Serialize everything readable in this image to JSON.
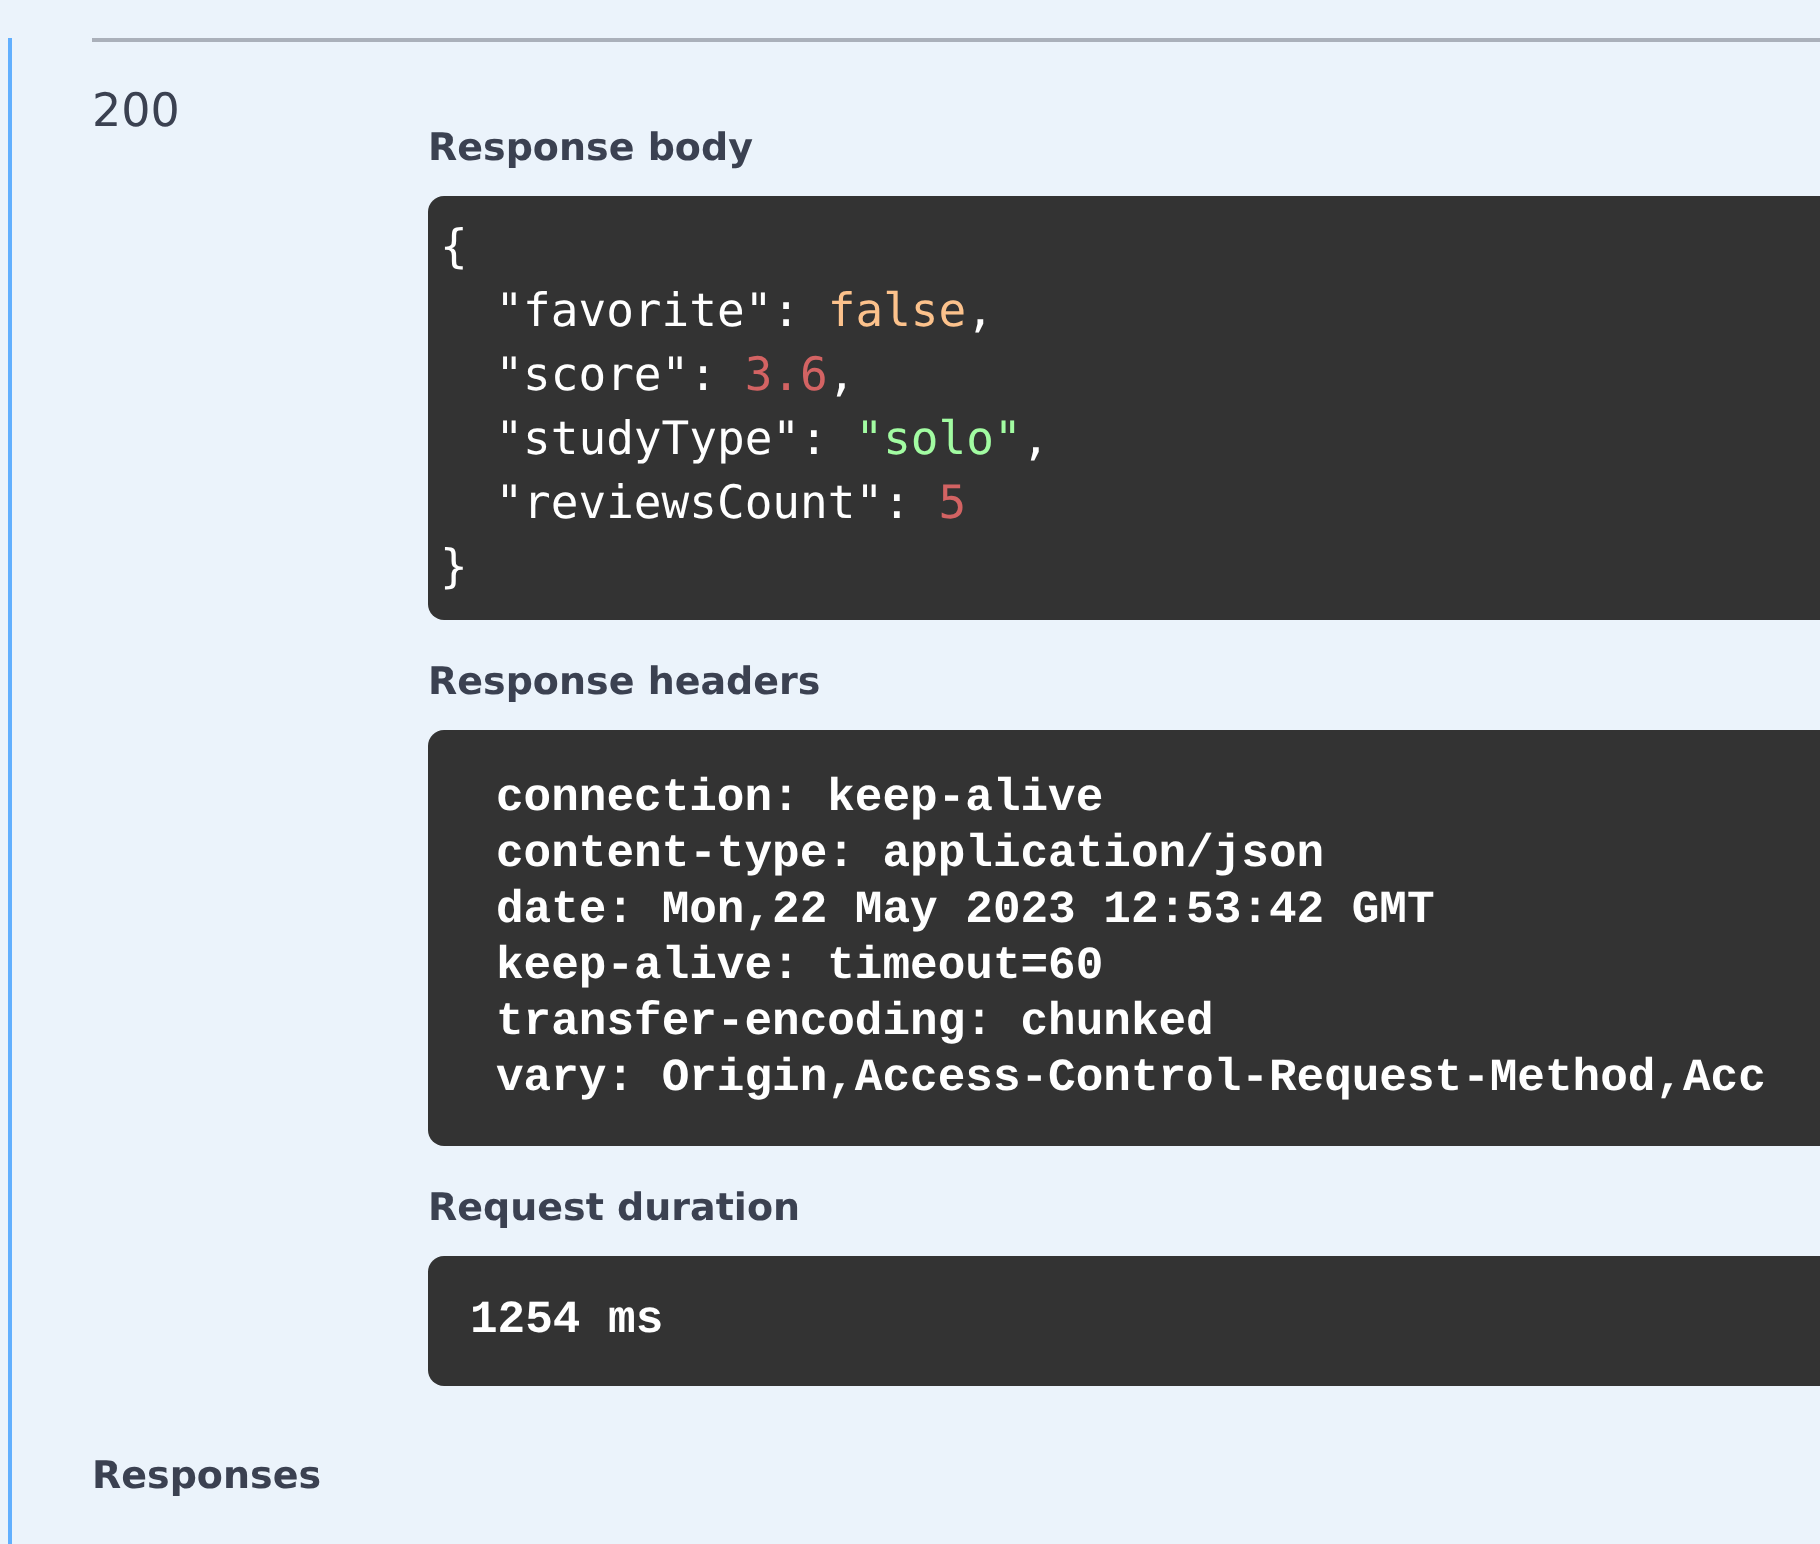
{
  "response": {
    "code": "200",
    "body_label": "Response body",
    "body_lines": [
      [
        {
          "kind": "punct",
          "text": "{"
        }
      ],
      [
        {
          "kind": "key",
          "text": "  \"favorite\": "
        },
        {
          "kind": "boolean",
          "text": "false"
        },
        {
          "kind": "punct",
          "text": ","
        }
      ],
      [
        {
          "kind": "key",
          "text": "  \"score\": "
        },
        {
          "kind": "number",
          "text": "3.6"
        },
        {
          "kind": "punct",
          "text": ","
        }
      ],
      [
        {
          "kind": "key",
          "text": "  \"studyType\": "
        },
        {
          "kind": "string",
          "text": "\"solo\""
        },
        {
          "kind": "punct",
          "text": ","
        }
      ],
      [
        {
          "kind": "key",
          "text": "  \"reviewsCount\": "
        },
        {
          "kind": "number",
          "text": "5"
        }
      ],
      [
        {
          "kind": "punct",
          "text": "}"
        }
      ]
    ],
    "headers_label": "Response headers",
    "headers": [
      "connection: keep-alive",
      "content-type: application/json",
      "date: Mon,22 May 2023 12:53:42 GMT",
      "keep-alive: timeout=60",
      "transfer-encoding: chunked",
      "vary: Origin,Access-Control-Request-Method,Acc"
    ],
    "duration_label": "Request duration",
    "duration": "1254 ms"
  },
  "responses_heading": "Responses"
}
